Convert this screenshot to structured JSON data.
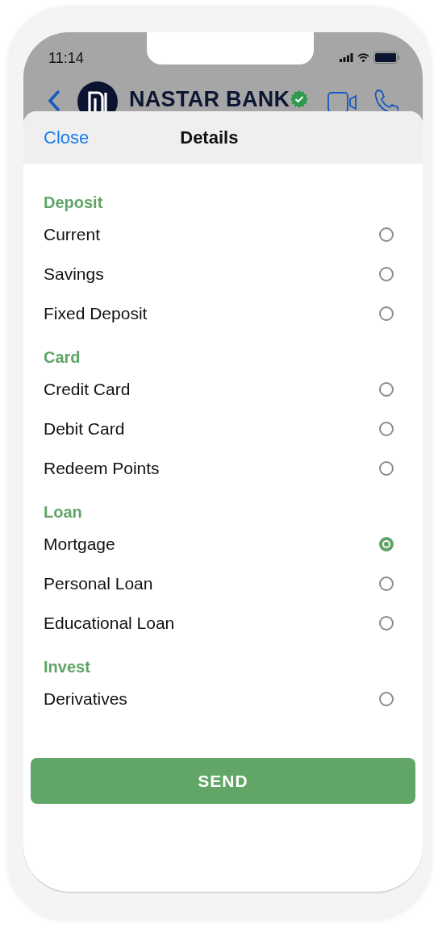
{
  "status_bar": {
    "time": "11:14"
  },
  "chat_header": {
    "name": "NASTAR BANK",
    "verified": true
  },
  "sheet": {
    "close": "Close",
    "title": "Details"
  },
  "sections": [
    {
      "title": "Deposit",
      "options": [
        {
          "label": "Current",
          "selected": false
        },
        {
          "label": "Savings",
          "selected": false
        },
        {
          "label": "Fixed Deposit",
          "selected": false
        }
      ]
    },
    {
      "title": "Card",
      "options": [
        {
          "label": "Credit Card",
          "selected": false
        },
        {
          "label": "Debit Card",
          "selected": false
        },
        {
          "label": "Redeem Points",
          "selected": false
        }
      ]
    },
    {
      "title": "Loan",
      "options": [
        {
          "label": "Mortgage",
          "selected": true
        },
        {
          "label": "Personal Loan",
          "selected": false
        },
        {
          "label": "Educational Loan",
          "selected": false
        }
      ]
    },
    {
      "title": "Invest",
      "options": [
        {
          "label": "Derivatives",
          "selected": false
        }
      ]
    }
  ],
  "send_button": "SEND"
}
